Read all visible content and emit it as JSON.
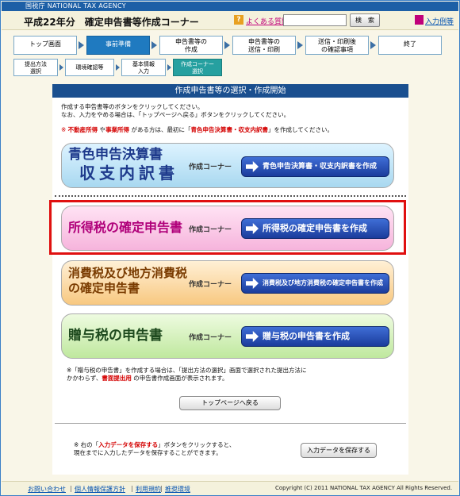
{
  "agency": "国税庁 NATIONAL TAX AGENCY",
  "header": {
    "title": "平成22年分　確定申告書等作成コーナー",
    "faq_label": "よくある質問",
    "search_placeholder": "",
    "search_button": "検　索",
    "example_label": "入力例等"
  },
  "steps": [
    {
      "label": "トップ画面"
    },
    {
      "label": "事前準備"
    },
    {
      "label": "申告書等の\n作成"
    },
    {
      "label": "申告書等の\n送信・印刷"
    },
    {
      "label": "送信・印刷後\nの確認事項"
    },
    {
      "label": "終了"
    }
  ],
  "substeps": [
    {
      "label": "提出方法\n選択"
    },
    {
      "label": "環境確認等"
    },
    {
      "label": "基本情報\n入力"
    },
    {
      "label": "作成コーナー\n選択"
    }
  ],
  "panel": {
    "title": "作成申告書等の選択・作成開始",
    "intro_line1": "作成する申告書等のボタンをクリックしてください。",
    "intro_line2": "なお、入力をやめる場合は、「トップページへ戻る」ボタンをクリックしてください。",
    "note_prefix": "※ ",
    "note_red1": "不動産所得",
    "note_mid1": " や",
    "note_red2": "事業所得",
    "note_mid2": " がある方は、最初に「",
    "note_red3": "青色申告決算書・収支内訳書",
    "note_suffix": "」を作成してください。"
  },
  "corner_label": "作成コーナー",
  "cards": [
    {
      "main_line1": "青色申告決算書",
      "main_line2": "収支内訳書",
      "button": "青色申告決算書・収支内訳書を作成"
    },
    {
      "main_line1": "所得税の確定申告書",
      "main_line2": "",
      "button": "所得税の確定申告書を作成"
    },
    {
      "main_line1": "消費税及び地方消費税",
      "main_line2": "の確定申告書",
      "button": "消費税及び地方消費税の確定申告書を作成"
    },
    {
      "main_line1": "贈与税の申告書",
      "main_line2": "",
      "button": "贈与税の申告書を作成"
    }
  ],
  "footnote": {
    "line1": "※「贈与税の申告書」を作成する場合は、「提出方法の選択」画面で選択された提出方法に",
    "line2_prefix": "かかわらず、",
    "line2_red": "書面提出用",
    "line2_suffix": " の申告書作成画面が表示されます。"
  },
  "top_button": "トップページへ戻る",
  "save_note": {
    "prefix": "※ 右の「",
    "red": "入力データを保存する",
    "suffix": "」ボタンをクリックすると、",
    "line2": "現在までに入力したデータを保存することができます。"
  },
  "save_button": "入力データを保存する",
  "footer": {
    "links": [
      "お問い合わせ",
      "個人情報保護方針",
      "利用規約",
      "推奨環境"
    ],
    "copyright": "Copyright (C) 2011 NATIONAL TAX AGENCY All Rights Reserved."
  }
}
